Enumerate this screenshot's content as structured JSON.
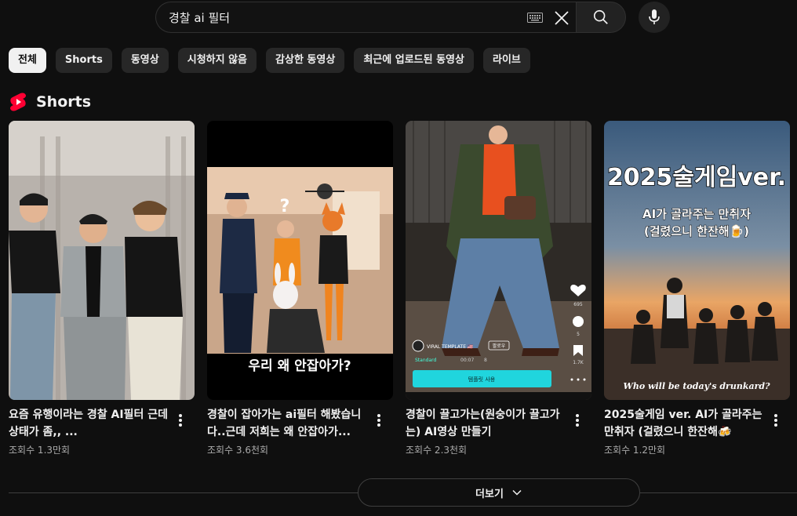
{
  "search": {
    "query": "경찰 ai 필터",
    "keyboard_icon": "keyboard-icon",
    "clear_icon": "close-icon",
    "search_icon": "search-icon",
    "mic_icon": "microphone-icon"
  },
  "chips": [
    {
      "label": "전체",
      "active": true
    },
    {
      "label": "Shorts",
      "active": false
    },
    {
      "label": "동영상",
      "active": false
    },
    {
      "label": "시청하지 않음",
      "active": false
    },
    {
      "label": "감상한 동영상",
      "active": false
    },
    {
      "label": "최근에 업로드된 동영상",
      "active": false
    },
    {
      "label": "라이브",
      "active": false
    }
  ],
  "section": {
    "title": "Shorts",
    "icon": "shorts-logo-icon",
    "accent_color": "#ff0033"
  },
  "shorts": [
    {
      "title": "요즘 유행이라는 경찰 AI필터 근데 상태가 좀,, ...",
      "views": "조회수 1.3만회"
    },
    {
      "title": "경찰이 잡아가는 ai필터 해봤습니다..근데 저희는 왜 안잡아가...",
      "views": "조회수 3.6천회",
      "overlay_text": "우리 왜 안잡아가?",
      "overlay_mark": "?"
    },
    {
      "title": "경찰이 끌고가는(원숭이가 끌고가는) AI영상 만들기",
      "views": "조회수 2.3천회",
      "overlay_template": "VIRAL TEMPLATE 🇺🇸",
      "overlay_follow": "팔로우",
      "overlay_standard": "Standard",
      "overlay_time": "00:07",
      "overlay_count": "8",
      "overlay_likes": "695",
      "overlay_comments": "5",
      "overlay_saves": "1.7K",
      "overlay_use_button": "템플릿 사용"
    },
    {
      "title": "2025술게임 ver. AI가 골라주는 만취자 (걸렸으니 한잔해🍻",
      "views": "조회수 1.2만회",
      "overlay_headline": "2025술게임ver.",
      "overlay_sub1": "AI가 골라주는 만취자",
      "overlay_sub2": "(걸렸으니 한잔해🍺)",
      "overlay_caption": "Who will be today's drunkard?"
    }
  ],
  "more_button": {
    "label": "더보기",
    "icon": "chevron-down-icon"
  }
}
